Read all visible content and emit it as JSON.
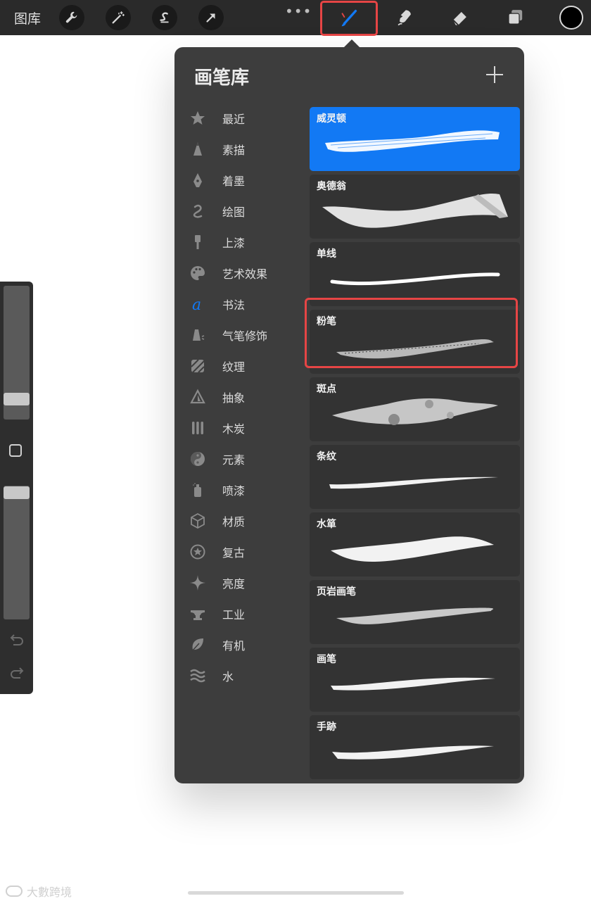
{
  "toolbar": {
    "gallery": "图库",
    "more": "•••"
  },
  "panel": {
    "title": "画笔库"
  },
  "categories": [
    {
      "label": "最近",
      "icon": "star-icon"
    },
    {
      "label": "素描",
      "icon": "pencil-tip-icon"
    },
    {
      "label": "着墨",
      "icon": "pen-nib-icon"
    },
    {
      "label": "绘图",
      "icon": "squiggle-icon"
    },
    {
      "label": "上漆",
      "icon": "paint-brush-icon"
    },
    {
      "label": "艺术效果",
      "icon": "palette-icon"
    },
    {
      "label": "书法",
      "icon": "calligraphy-a-icon"
    },
    {
      "label": "气笔修饰",
      "icon": "airbrush-icon"
    },
    {
      "label": "纹理",
      "icon": "texture-icon"
    },
    {
      "label": "抽象",
      "icon": "triangle-icon"
    },
    {
      "label": "木炭",
      "icon": "charcoal-icon"
    },
    {
      "label": "元素",
      "icon": "yin-yang-icon"
    },
    {
      "label": "喷漆",
      "icon": "spray-can-icon"
    },
    {
      "label": "材质",
      "icon": "cube-icon"
    },
    {
      "label": "复古",
      "icon": "retro-star-icon"
    },
    {
      "label": "亮度",
      "icon": "sparkle-icon"
    },
    {
      "label": "工业",
      "icon": "anvil-icon"
    },
    {
      "label": "有机",
      "icon": "leaf-icon"
    },
    {
      "label": "水",
      "icon": "waves-icon"
    }
  ],
  "brushes": [
    {
      "name": "威灵顿",
      "selected": true
    },
    {
      "name": "奥德翁"
    },
    {
      "name": "单线"
    },
    {
      "name": "粉笔"
    },
    {
      "name": "斑点"
    },
    {
      "name": "条纹"
    },
    {
      "name": "水箪"
    },
    {
      "name": "页岩画笔"
    },
    {
      "name": "画笔"
    },
    {
      "name": "手跡"
    }
  ],
  "colors": {
    "accent": "#1279f4",
    "highlight": "#e64545",
    "panel": "#3d3d3d",
    "toolbar": "#2a2a2a"
  },
  "watermark": "大數跨境"
}
